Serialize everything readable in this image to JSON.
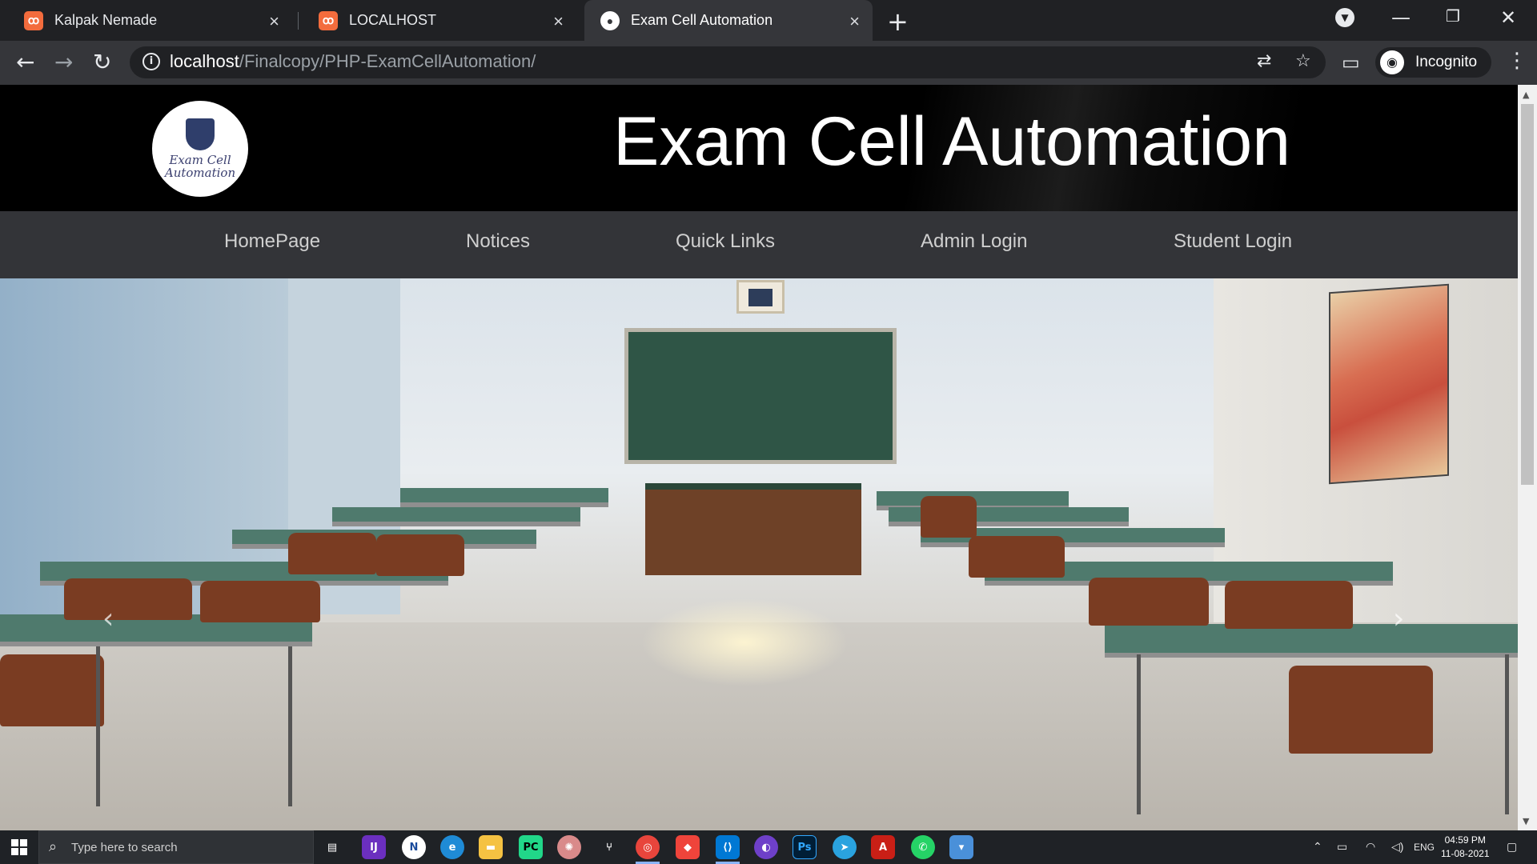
{
  "browser": {
    "tabs": [
      {
        "title": "Kalpak Nemade",
        "icon": "xampp-icon",
        "active": false
      },
      {
        "title": "LOCALHOST",
        "icon": "xampp-icon",
        "active": false
      },
      {
        "title": "Exam Cell Automation",
        "icon": "site-favicon",
        "active": true
      }
    ],
    "url_host": "localhost",
    "url_path": "/Finalcopy/PHP-ExamCellAutomation/",
    "profile_label": "Incognito"
  },
  "site": {
    "logo_text": [
      "Exam Cell",
      "Automation"
    ],
    "title": "Exam Cell Automation",
    "nav": [
      "HomePage",
      "Notices",
      "Quick Links",
      "Admin Login",
      "Student Login"
    ],
    "carousel": {
      "prev": "‹",
      "next": "›"
    }
  },
  "taskbar": {
    "search_placeholder": "Type here to search",
    "language": "ENG",
    "time": "04:59 PM",
    "date": "11-08-2021",
    "apps": [
      "task-view-icon",
      "jetbrains-icon",
      "app-icon",
      "edge-icon",
      "file-explorer-icon",
      "pycharm-icon",
      "brain-icon",
      "git-icon",
      "chrome-icon",
      "anydesk-icon",
      "vscode-icon",
      "github-desktop-icon",
      "photoshop-icon",
      "telegram-icon",
      "acrobat-icon",
      "whatsapp-icon",
      "app-icon-2"
    ]
  }
}
